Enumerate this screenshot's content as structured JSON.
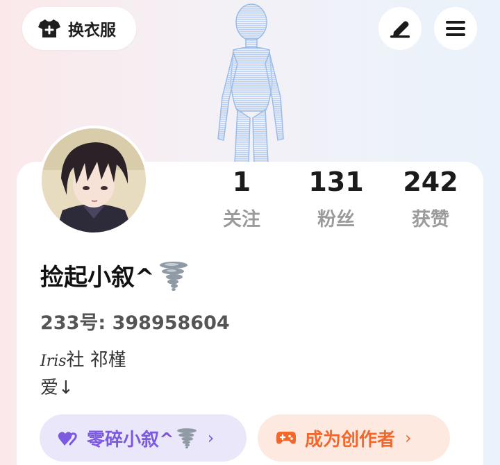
{
  "topbar": {
    "dress_label": "换衣服"
  },
  "profile": {
    "username": "捡起小叙^",
    "uid_label": "233号:",
    "uid_value": "398958604",
    "bio_script": "Iris",
    "bio_line1_rest": "社 祁槿",
    "bio_line2": "爱↓"
  },
  "stats": [
    {
      "value": "1",
      "label": "关注"
    },
    {
      "value": "131",
      "label": "粉丝"
    },
    {
      "value": "242",
      "label": "获赞"
    }
  ],
  "actions": {
    "suixu_label": "零碎小叙^",
    "creator_label": "成为创作者"
  },
  "colors": {
    "purple_accent": "#7b5ae0",
    "orange_accent": "#f2682c",
    "hologram": "#a9c6ee"
  }
}
